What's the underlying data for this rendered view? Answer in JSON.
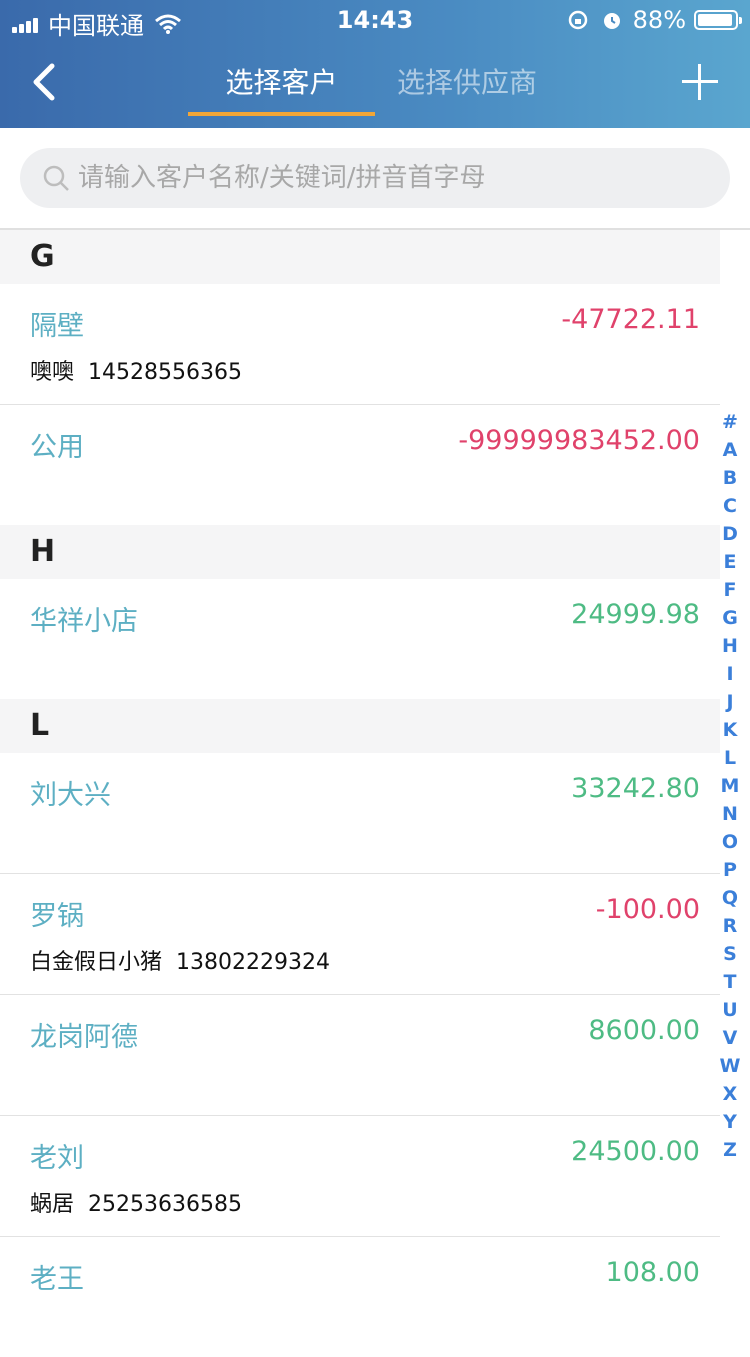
{
  "status_bar": {
    "carrier": "中国联通",
    "time": "14:43",
    "battery": "88%"
  },
  "nav": {
    "tabs": [
      {
        "label": "选择客户"
      },
      {
        "label": "选择供应商"
      }
    ]
  },
  "search": {
    "placeholder": "请输入客户名称/关键词/拼音首字母"
  },
  "sections": [
    {
      "letter": "G",
      "rows": [
        {
          "name": "隔壁",
          "amount": "-47722.11",
          "contact": "噢噢",
          "phone": "14528556365"
        },
        {
          "name": "公用",
          "amount": "-99999983452.00",
          "contact": "",
          "phone": ""
        }
      ]
    },
    {
      "letter": "H",
      "rows": [
        {
          "name": "华祥小店",
          "amount": "24999.98",
          "contact": "",
          "phone": ""
        }
      ]
    },
    {
      "letter": "L",
      "rows": [
        {
          "name": "刘大兴",
          "amount": "33242.80",
          "contact": "",
          "phone": ""
        },
        {
          "name": "罗锅",
          "amount": "-100.00",
          "contact": "白金假日小猪",
          "phone": "13802229324"
        },
        {
          "name": "龙岗阿德",
          "amount": "8600.00",
          "contact": "",
          "phone": ""
        },
        {
          "name": "老刘",
          "amount": "24500.00",
          "contact": "蜗居",
          "phone": "25253636585"
        },
        {
          "name": "老王",
          "amount": "108.00",
          "contact": "",
          "phone": ""
        }
      ]
    }
  ],
  "index_letters": [
    "#",
    "A",
    "B",
    "C",
    "D",
    "E",
    "F",
    "G",
    "H",
    "I",
    "J",
    "K",
    "L",
    "M",
    "N",
    "O",
    "P",
    "Q",
    "R",
    "S",
    "T",
    "U",
    "V",
    "W",
    "X",
    "Y",
    "Z"
  ],
  "colors": {
    "header_start": "#3a6aab",
    "header_end": "#5aa6cf",
    "tab_underline": "#f2a637",
    "name": "#5dafc3",
    "negative": "#e0426b",
    "positive": "#4ebb84",
    "index": "#3b7fd9"
  }
}
